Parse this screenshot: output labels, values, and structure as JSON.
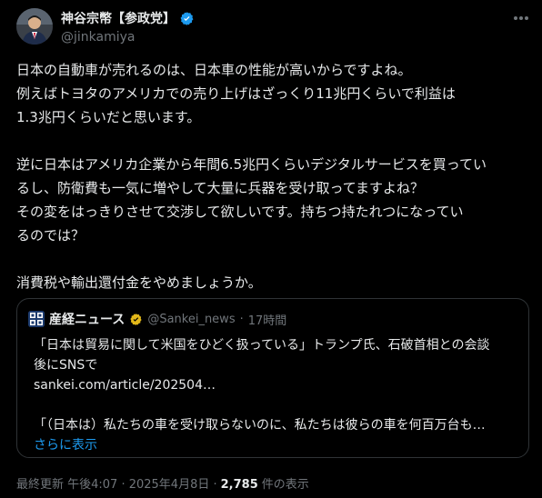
{
  "author": {
    "name": "神谷宗幣【参政党】",
    "handle": "@jinkamiya"
  },
  "tweet_lines": [
    "日本の自動車が売れるのは、日本車の性能が高いからですよね。",
    "例えばトヨタのアメリカでの売り上げはざっくり11兆円くらいで利益は",
    "1.3兆円くらいだと思います。",
    "",
    "逆に日本はアメリカ企業から年間6.5兆円くらいデジタルサービスを買ってい",
    "るし、防衛費も一気に増やして大量に兵器を受け取ってますよね？",
    "その変をはっきりさせて交渉して欲しいです。持ちつ持たれつになってい",
    "るのでは？",
    "",
    "消費税や輸出還付金をやめましょうか。"
  ],
  "quote": {
    "logo_text": "産経新聞",
    "name": "産経ニュース",
    "handle": "@Sankei_news",
    "separator": "·",
    "time": "17時間",
    "line1": "「日本は貿易に関して米国をひどく扱っている」トランプ氏、石破首相との会談",
    "line2": "後にSNSで",
    "link": "sankei.com/article/202504…",
    "line4": "「（日本は）私たちの車を受け取らないのに、私たちは彼らの車を何百万台も…",
    "show_more": "さらに表示"
  },
  "footer": {
    "updated": "最終更新 午後4:07 · 2025年4月8日 ·",
    "views_count": "2,785",
    "views_label": "件の表示"
  },
  "colors": {
    "background": "#000000",
    "text": "#e7e9ea",
    "muted": "#71767b",
    "accent": "#1d9bf0",
    "border": "#2f3336"
  },
  "icons": {
    "verified": "verified-badge-icon",
    "more": "more-options-icon"
  }
}
